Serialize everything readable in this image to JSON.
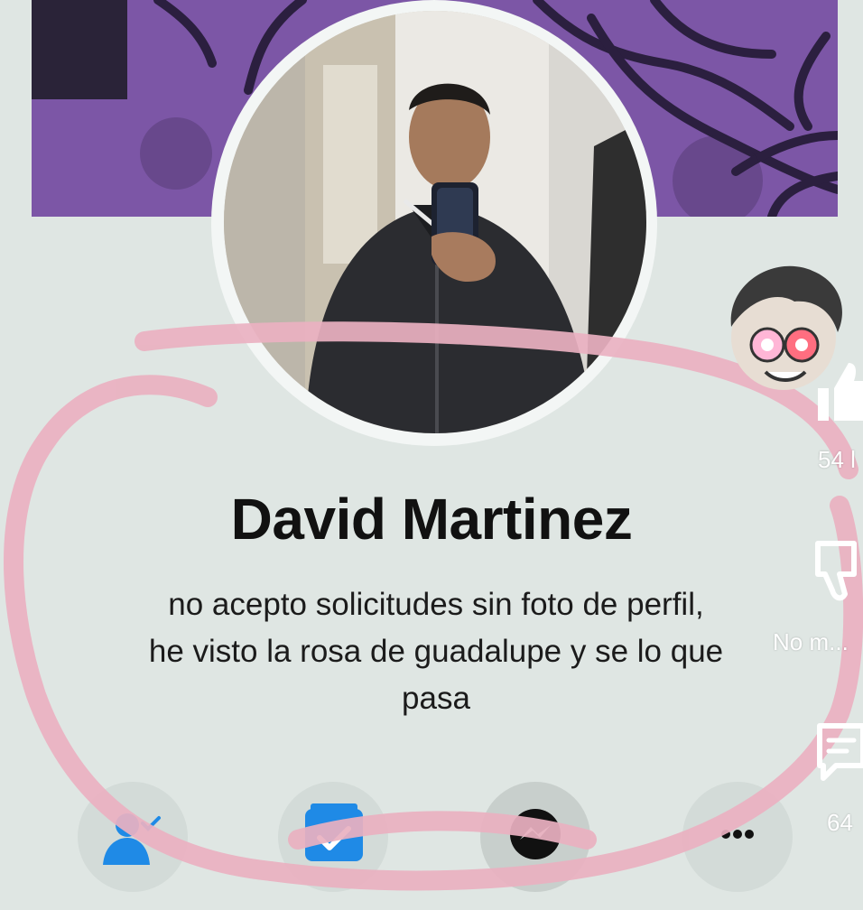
{
  "profile": {
    "name": "David Martinez",
    "bio_lines": [
      "no acepto solicitudes sin foto de perfil,",
      "he visto la rosa de guadalupe y se lo que",
      "pasa"
    ]
  },
  "actions": [
    {
      "icon": "friends-check-icon"
    },
    {
      "icon": "calendar-check-icon"
    },
    {
      "icon": "messenger-icon"
    },
    {
      "icon": "more-dots-icon"
    }
  ],
  "side_panel": {
    "likes_count": "54 l",
    "dislike_label": "No m...",
    "comments_count": "64"
  },
  "colors": {
    "cover_purple": "#7c56a6",
    "scribble_pink": "#eab1c1",
    "accent_blue": "#1f8ae6"
  }
}
